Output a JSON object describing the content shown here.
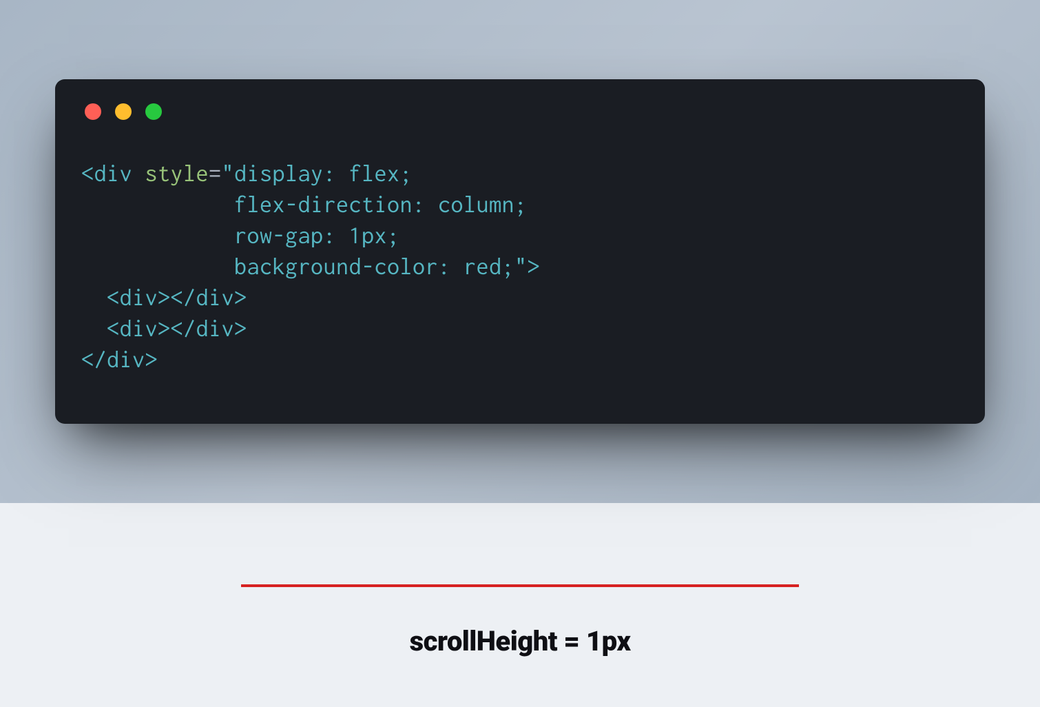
{
  "code": {
    "line1_prefix": "<div ",
    "line1_attr": "style",
    "line1_eq": "=",
    "line1_str": "\"display: flex;",
    "line2_str": "            flex-direction: column;",
    "line3_str": "            row-gap: 1px;",
    "line4_str": "            background-color: red;\"",
    "line4_suffix": ">",
    "line5": "  <div></div>",
    "line6": "  <div></div>",
    "line7": "</div>"
  },
  "caption": "scrollHeight = 1px",
  "colors": {
    "red_line": "#d72222",
    "window_bg": "#1a1d23"
  }
}
